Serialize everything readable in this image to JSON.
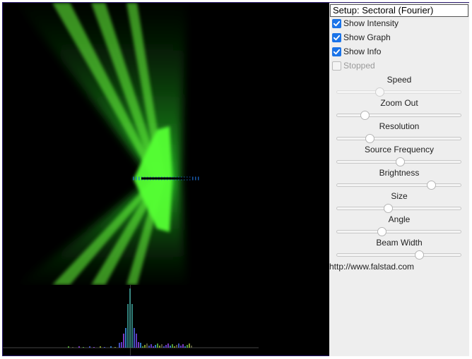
{
  "setup": {
    "selected": "Setup: Sectoral (Fourier)"
  },
  "checkboxes": [
    {
      "label": "Show Intensity",
      "checked": true,
      "disabled": false
    },
    {
      "label": "Show Graph",
      "checked": true,
      "disabled": false
    },
    {
      "label": "Show Info",
      "checked": true,
      "disabled": false
    },
    {
      "label": "Stopped",
      "checked": false,
      "disabled": true
    }
  ],
  "sliders": [
    {
      "label": "Speed",
      "value": 0.34,
      "disabled": true
    },
    {
      "label": "Zoom Out",
      "value": 0.22,
      "disabled": false
    },
    {
      "label": "Resolution",
      "value": 0.26,
      "disabled": false
    },
    {
      "label": "Source Frequency",
      "value": 0.51,
      "disabled": false
    },
    {
      "label": "Brightness",
      "value": 0.76,
      "disabled": false
    },
    {
      "label": "Size",
      "value": 0.41,
      "disabled": false
    },
    {
      "label": "Angle",
      "value": 0.36,
      "disabled": false
    },
    {
      "label": "Beam Width",
      "value": 0.66,
      "disabled": false
    }
  ],
  "link": {
    "text": "http://www.falstad.com"
  },
  "colors": {
    "wave": "#22cc22",
    "background": "#000000",
    "panel": "#eeeeee",
    "checkbox": "#1a73e8"
  }
}
